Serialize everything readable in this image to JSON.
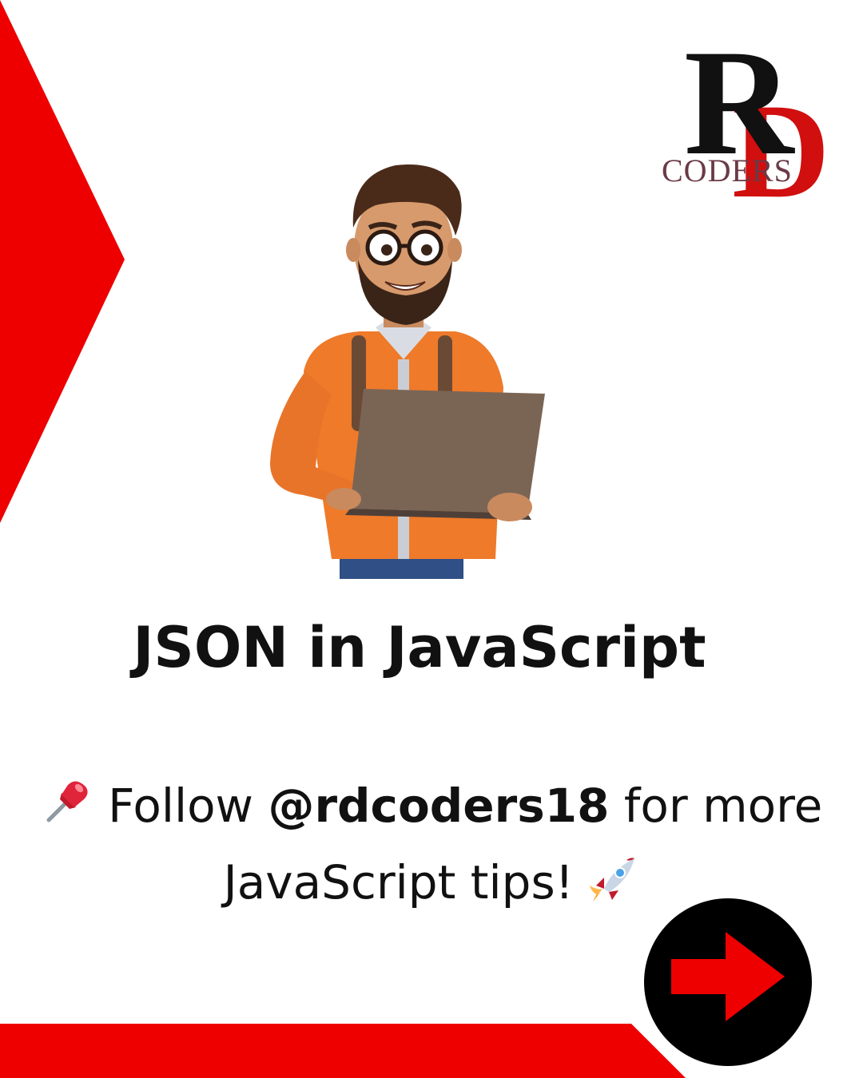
{
  "logo": {
    "letter_r": "R",
    "letter_d": "D",
    "wordmark": "CODERS"
  },
  "title": "JSON in JavaScript",
  "cta": {
    "pin_emoji": "pushpin-icon",
    "before": "Follow",
    "handle": "@rdcoders18",
    "middle": "for more",
    "line2": "JavaScript tips!",
    "end_emoji": "rocket-icon"
  },
  "next_button": {
    "icon": "arrow-right-icon"
  },
  "colors": {
    "accent": "#ee0000",
    "text": "#111111",
    "button": "#000000",
    "background": "#ffffff"
  }
}
